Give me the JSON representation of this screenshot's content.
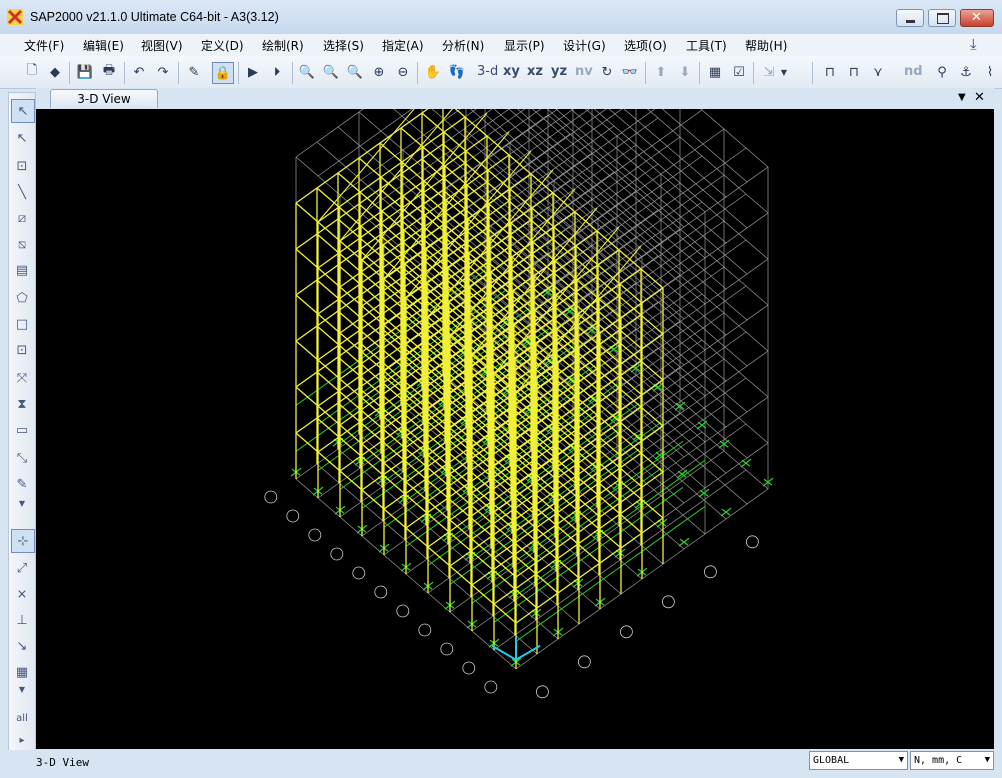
{
  "window": {
    "title": "SAP2000 v21.1.0 Ultimate C64-bit - A3(3.12)"
  },
  "menu": [
    "文件(F)",
    "编辑(E)",
    "视图(V)",
    "定义(D)",
    "绘制(R)",
    "选择(S)",
    "指定(A)",
    "分析(N)",
    "显示(P)",
    "设计(G)",
    "选项(O)",
    "工具(T)",
    "帮助(H)"
  ],
  "toolbar": {
    "views": [
      "3-d",
      "xy",
      "xz",
      "yz",
      "nv"
    ],
    "nd": "nd"
  },
  "tab": {
    "label": "3-D View"
  },
  "status": {
    "text": "3-D View",
    "coord_system": "GLOBAL",
    "units": "N, mm, C"
  },
  "colors": {
    "frame": "#f0f03a",
    "grid": "#9a9a9a",
    "support": "#26d626",
    "background": "#000000"
  }
}
